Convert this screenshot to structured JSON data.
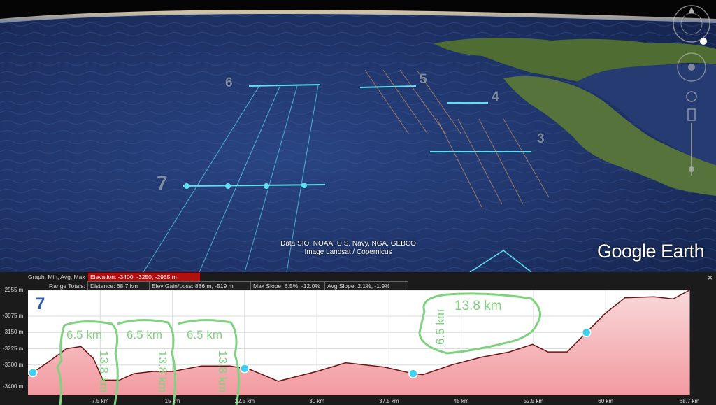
{
  "map": {
    "attribution_line1": "Data SIO, NOAA, U.S. Navy, NGA, GEBCO",
    "attribution_line2": "Image Landsat / Copernicus",
    "logo_word1": "Google",
    "logo_word2": "Earth",
    "area_labels": [
      "6",
      "5",
      "4",
      "3",
      "7"
    ],
    "colors": {
      "ocean": "#1e3266",
      "land": "#4f6d33",
      "track": "#5fe0f0",
      "sky": "#050505"
    }
  },
  "profile_panel": {
    "graph_label": "Graph: Min, Avg, Max",
    "elevation_stat": "Elevation: -3400, -3250, -2955 m",
    "range_totals_label": "Range Totals:",
    "distance_stat": "Distance: 68.7 km",
    "elev_gain_loss_stat": "Elev Gain/Loss: 886 m, -519 m",
    "max_slope_stat": "Max Slope: 6.5%, -12.0%",
    "avg_slope_stat": "Avg Slope: 2.1%, -1.9%",
    "close_glyph": "×",
    "title": "7",
    "annotations": {
      "swath1_width": "6.5 km",
      "swath2_width": "6.5 km",
      "swath3_width": "6.5 km",
      "swath1_length": "13.8 km",
      "swath2_length": "13.8 km",
      "swath3_length": "13.8 km",
      "box_length": "13.8 km",
      "box_width": "6.5 km"
    }
  },
  "chart_data": {
    "type": "area",
    "xlabel": "",
    "ylabel": "",
    "xlim": [
      0,
      68.7
    ],
    "ylim": [
      -3440,
      -2955
    ],
    "y_ticks": [
      -2955,
      -3075,
      -3150,
      -3225,
      -3300,
      -3400
    ],
    "y_tick_labels": [
      "-2955 m",
      "-3075 m",
      "-3150 m",
      "-3225 m",
      "-3300 m",
      "-3400 m"
    ],
    "x_ticks": [
      7.5,
      15,
      22.5,
      30,
      37.5,
      45,
      52.5,
      60,
      68.7
    ],
    "x_tick_labels": [
      "7.5 km",
      "15 km",
      "22.5 km",
      "30 km",
      "37.5 km",
      "45 km",
      "52.5 km",
      "60 km",
      "68.7 km"
    ],
    "series": [
      {
        "x": [
          0,
          2,
          4,
          5.5,
          6.8,
          7.8,
          9.5,
          11,
          13,
          15,
          18,
          21,
          23,
          26,
          30,
          33,
          37,
          40,
          41,
          44,
          47,
          50,
          52.4,
          54,
          56,
          58,
          60,
          62,
          65,
          67,
          68.7
        ],
        "values": [
          -3350,
          -3290,
          -3225,
          -3215,
          -3270,
          -3370,
          -3370,
          -3340,
          -3330,
          -3330,
          -3305,
          -3305,
          -3320,
          -3375,
          -3330,
          -3290,
          -3310,
          -3340,
          -3345,
          -3300,
          -3265,
          -3240,
          -3205,
          -3240,
          -3240,
          -3150,
          -3060,
          -2990,
          -2985,
          -2995,
          -2955
        ]
      }
    ],
    "markers_x": [
      0.5,
      22.5,
      40,
      58
    ],
    "grid": true,
    "colors": {
      "line": "#6a1414",
      "fill_top": "#f9d9db",
      "fill_bottom": "#f29aa0",
      "marker": "#3fd0f0"
    }
  }
}
